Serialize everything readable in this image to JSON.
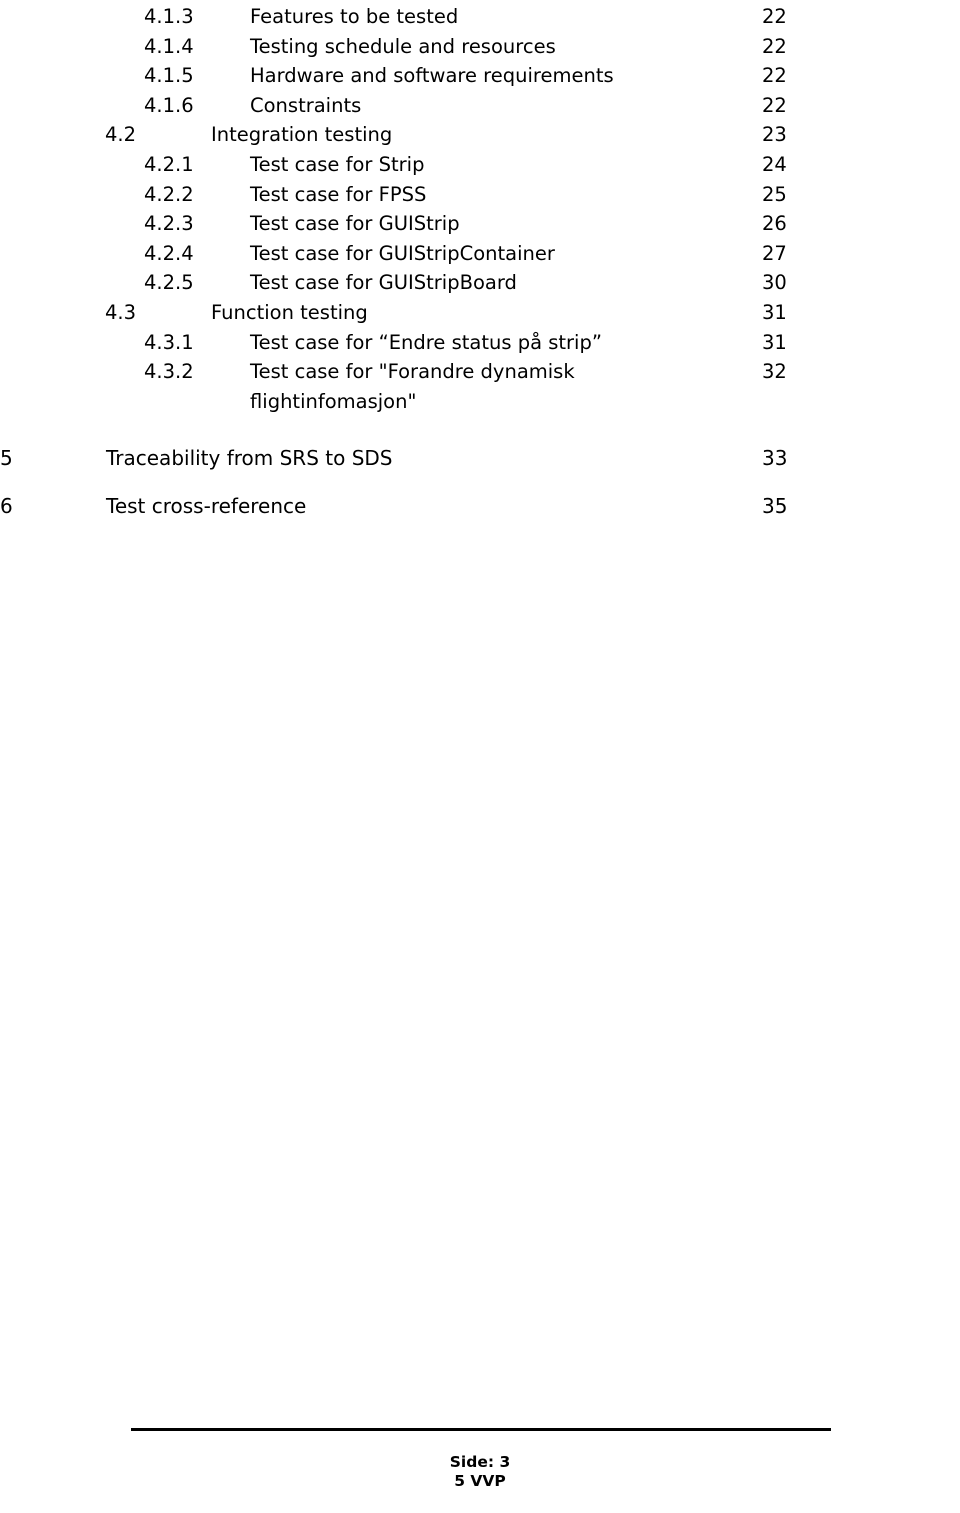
{
  "document": {
    "toc_entries": [
      {
        "level": 3,
        "number": "4.1.3",
        "title": "Features to be tested",
        "page": "22"
      },
      {
        "level": 3,
        "number": "4.1.4",
        "title": "Testing schedule and resources",
        "page": "22"
      },
      {
        "level": 3,
        "number": "4.1.5",
        "title": "Hardware and software requirements",
        "page": "22"
      },
      {
        "level": 3,
        "number": "4.1.6",
        "title": "Constraints",
        "page": "22"
      },
      {
        "level": 2,
        "number": "4.2",
        "title": "Integration testing",
        "page": "23"
      },
      {
        "level": 3,
        "number": "4.2.1",
        "title": "Test case for Strip",
        "page": "24"
      },
      {
        "level": 3,
        "number": "4.2.2",
        "title": "Test case for FPSS",
        "page": "25"
      },
      {
        "level": 3,
        "number": "4.2.3",
        "title": "Test case for GUIStrip",
        "page": "26"
      },
      {
        "level": 3,
        "number": "4.2.4",
        "title": "Test case for GUIStripContainer",
        "page": "27"
      },
      {
        "level": 3,
        "number": "4.2.5",
        "title": "Test case for GUIStripBoard",
        "page": "30"
      },
      {
        "level": 2,
        "number": "4.3",
        "title": "Function testing",
        "page": "31"
      },
      {
        "level": 3,
        "number": "4.3.1",
        "title": "Test case for “Endre status på strip”",
        "page": "31"
      },
      {
        "level": 3,
        "number": "4.3.2",
        "title": "Test case for \"Forandre dynamisk",
        "page": "32",
        "continuation": "flightinfomasjon\""
      },
      {
        "level": 1,
        "number": "5",
        "title": "Traceability from SRS to SDS",
        "page": "33",
        "spacer_before": "large"
      },
      {
        "level": 1,
        "number": "6",
        "title": "Test cross-reference",
        "page": "35",
        "spacer_before": "small"
      }
    ]
  },
  "footer": {
    "line1": "Side: 3",
    "line2": "5 VVP"
  }
}
